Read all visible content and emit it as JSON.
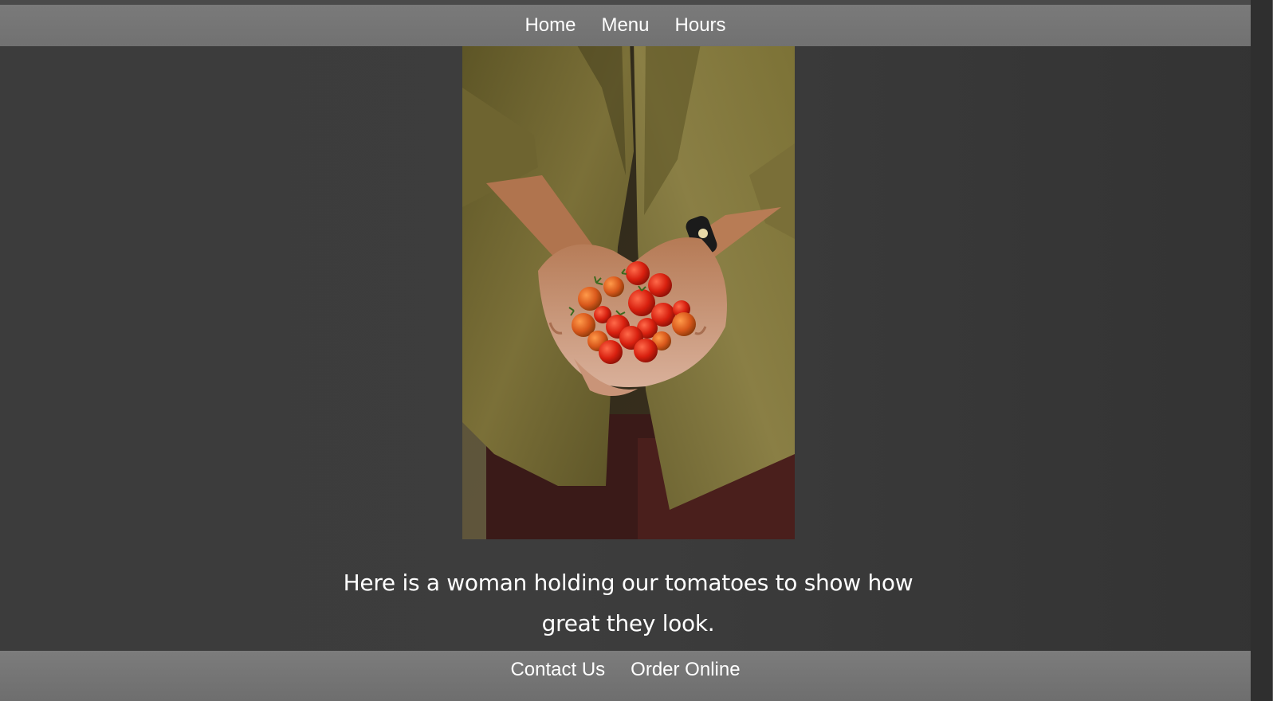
{
  "nav": {
    "items": [
      {
        "label": "Home"
      },
      {
        "label": "Menu"
      },
      {
        "label": "Hours"
      }
    ]
  },
  "hero": {
    "image_icon": "photo-woman-holding-tomatoes"
  },
  "caption": {
    "text": "Here is a woman holding our tomatoes to show how great they look."
  },
  "footer": {
    "links": [
      {
        "label": "Contact Us"
      },
      {
        "label": "Order Online"
      }
    ]
  },
  "colors": {
    "page_background": "#3a3a3a",
    "bar_background": "#767676",
    "text": "#ffffff"
  }
}
